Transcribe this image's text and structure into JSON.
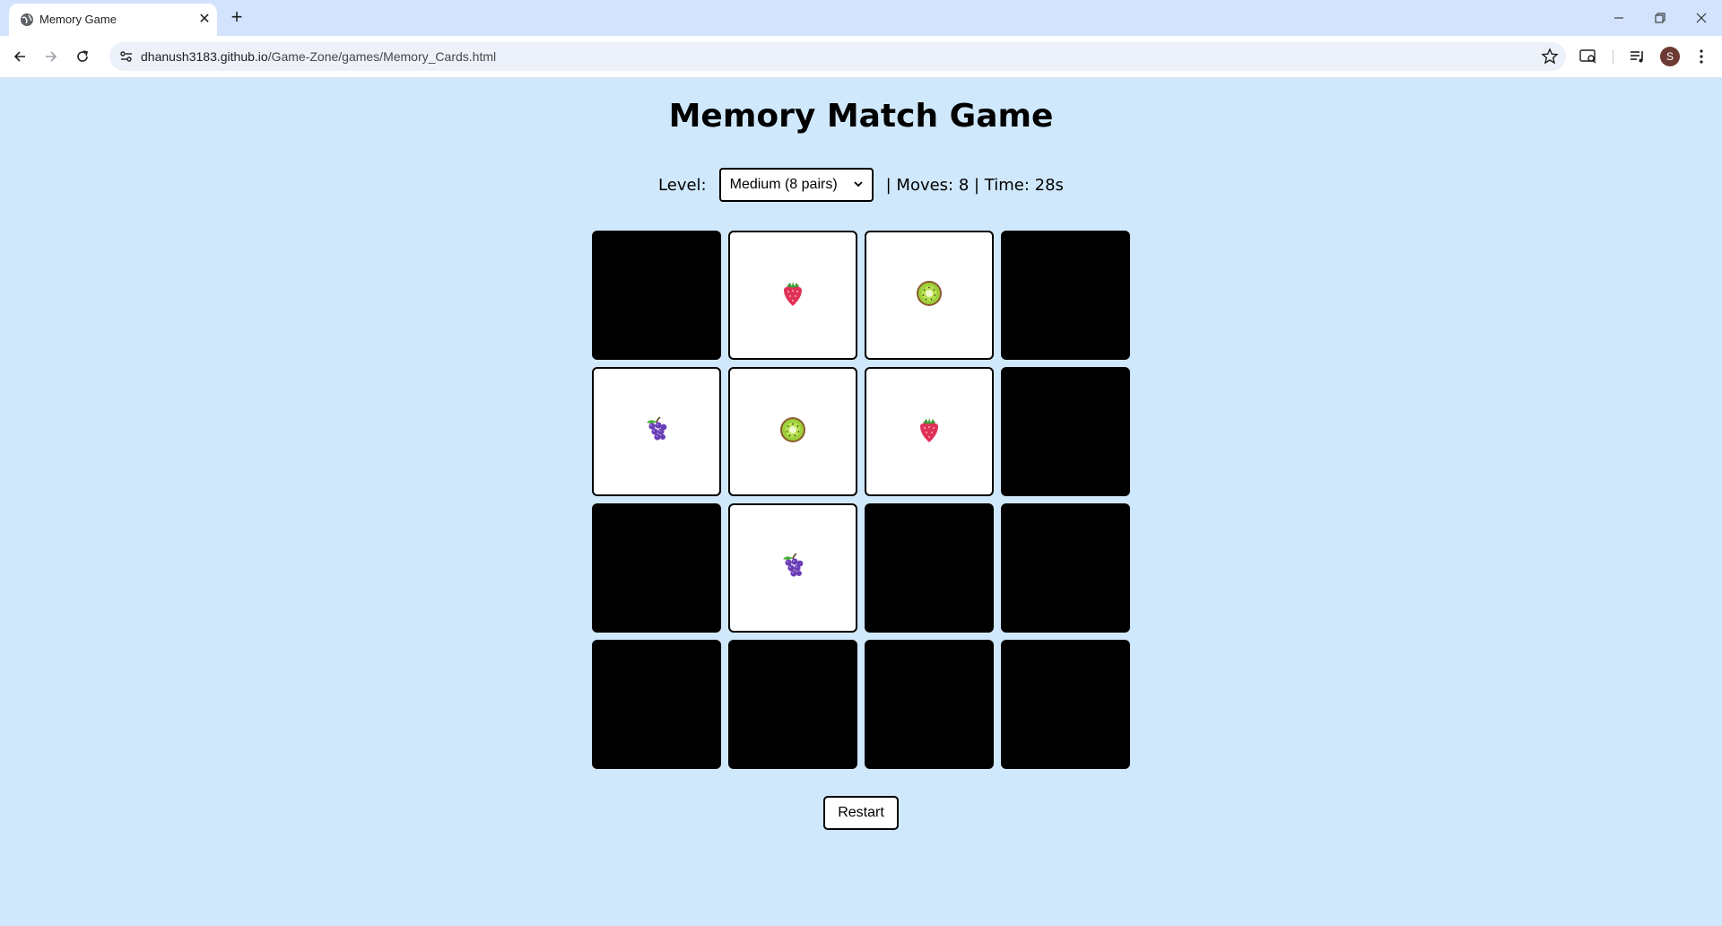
{
  "browser": {
    "tab_title": "Memory Game",
    "tab_close": "✕",
    "new_tab": "+",
    "url_host": "dhanush3183.github.io",
    "url_path": "/Game-Zone/games/Memory_Cards.html",
    "profile_initial": "S"
  },
  "game": {
    "title": "Memory Match Game",
    "level_label": "Level:",
    "level_selected": "Medium (8 pairs)",
    "stats": "| Moves: 8 | Time: 28s",
    "restart_label": "Restart",
    "cards": [
      {
        "state": "down",
        "icon": ""
      },
      {
        "state": "up",
        "icon": "strawberry"
      },
      {
        "state": "up",
        "icon": "kiwi"
      },
      {
        "state": "down",
        "icon": ""
      },
      {
        "state": "up",
        "icon": "grapes"
      },
      {
        "state": "up",
        "icon": "kiwi"
      },
      {
        "state": "up",
        "icon": "strawberry"
      },
      {
        "state": "down",
        "icon": ""
      },
      {
        "state": "down",
        "icon": ""
      },
      {
        "state": "up",
        "icon": "grapes"
      },
      {
        "state": "down",
        "icon": ""
      },
      {
        "state": "down",
        "icon": ""
      },
      {
        "state": "down",
        "icon": ""
      },
      {
        "state": "down",
        "icon": ""
      },
      {
        "state": "down",
        "icon": ""
      },
      {
        "state": "down",
        "icon": ""
      }
    ]
  },
  "colors": {
    "page_background": "#d0e8fb",
    "titlebar": "#d3e3fd",
    "card_back": "#000000",
    "card_face": "#ffffff"
  }
}
